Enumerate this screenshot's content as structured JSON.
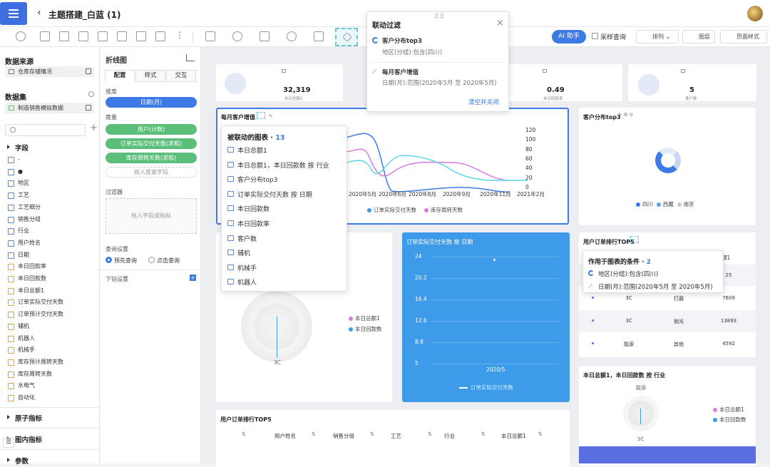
{
  "header": {
    "title": "主题搭建_白蓝 (1)"
  },
  "toolbar": {
    "ai_label": "AI 助手",
    "sample_label": "采样查询",
    "sort_label": "排列",
    "layer_label": "图层",
    "page_style_label": "页面样式"
  },
  "left": {
    "datasource_title": "数据来源",
    "datasource_item": "仓库存储情况",
    "dataset_title": "数据集",
    "dataset_item": "制造销售模拟数据",
    "fields_title": "字段",
    "fields": [
      "-",
      "●",
      "地区",
      "工艺",
      "工艺细分",
      "销售分组",
      "行业",
      "用户姓名",
      "日期",
      "本日回款率",
      "本日回款数",
      "本日总额1",
      "订单实际交付天数",
      "订单预计交付天数",
      "辅机",
      "机器人",
      "机械手",
      "库存预计周转天数",
      "库存周转天数",
      "水电气",
      "自动化"
    ],
    "cat_atomic": "原子指标",
    "cat_inmap": "图内指标",
    "cat_params": "参数"
  },
  "config": {
    "chart_type": "折线图",
    "tabs": [
      "配置",
      "样式",
      "交互"
    ],
    "dimension_label": "维度",
    "dimension_value": "日期(月)",
    "measure_label": "度量",
    "measures": [
      "用户(计数)",
      "订单实际交付天数(求和)",
      "库存周转天数(求和)"
    ],
    "measure_drop": "拖入度量字段",
    "filter_label": "过滤器",
    "filter_drop": "拖入字段或指标",
    "query_label": "查询设置",
    "query_opt1": "预先查询",
    "query_opt2": "点击查询",
    "drill_label": "下钻设置"
  },
  "kpis": [
    {
      "value": "32,319",
      "sub": "本日总额1"
    },
    {
      "value": "0.49",
      "sub": "本日回款率"
    },
    {
      "value": "5",
      "sub": "客户数"
    }
  ],
  "monthly_chart": {
    "title": "每月客户增值",
    "ticks_right": [
      "120",
      "100",
      "80",
      "60",
      "40",
      "20",
      "0"
    ],
    "x_ticks": [
      "2020年5月",
      "2020年6月",
      "2020年8月",
      "2020年9月",
      "2020年11月",
      "2021年2月"
    ],
    "legend": [
      "订单实际交付天数",
      "库存周转天数"
    ]
  },
  "pie_chart": {
    "title": "客户分布top3",
    "legend": [
      "四川",
      "西藏",
      "南京"
    ]
  },
  "blue_chart": {
    "title": "订单实际交付天数 按 日期",
    "yticks": [
      "24",
      "20.2",
      "16.4",
      "12.6",
      "8.8",
      "5"
    ],
    "xtick": "2020/5",
    "legend": "订单实际交付天数"
  },
  "radar_left": {
    "legend": [
      "本日总额1",
      "本日回款数"
    ],
    "label": "3C"
  },
  "rank_card": {
    "title": "用户订单排行TOP5",
    "header_partial": "额1",
    "rows": [
      {
        "c1": "",
        "c2": "",
        "c3": "25"
      },
      {
        "c1": "3C",
        "c2": "打磨",
        "c3": "7609"
      },
      {
        "c1": "3C",
        "c2": "抛光",
        "c3": "13893"
      },
      {
        "c1": "能源",
        "c2": "其他",
        "c3": "4592"
      }
    ]
  },
  "bottom_table": {
    "title": "用户订单排行TOP5",
    "headers": [
      "用户姓名",
      "销售分组",
      "工艺",
      "行业",
      "本日总额1"
    ]
  },
  "radar_right": {
    "title": "本日总额1，本日回款数 按 行业",
    "top_label": "能源",
    "bottom_label": "3C",
    "legend": [
      "本日总额1",
      "本日回款数"
    ]
  },
  "linked_popup": {
    "title": "被联动的图表",
    "count": "13",
    "items": [
      "本日总额1",
      "本日总额1，本日回款数 按 行业",
      "客户分布top3",
      "订单实际交付天数 按 日期",
      "本日回款数",
      "本日回款率",
      "客户数",
      "辅机",
      "机械手",
      "机器人"
    ]
  },
  "filter_popup": {
    "title": "联动过滤",
    "entry1_title": "客户分布top3",
    "entry1_cond": "地区(分组):包含(四川)",
    "entry2_title": "每月客户增值",
    "entry2_cond": "日期(月):范围(2020年5月 至 2020年5月)",
    "clear_label": "清空并关闭"
  },
  "conditions_popup": {
    "title": "作用于图表的条件",
    "count": "2",
    "items": [
      "地区(分组):包含(四川)",
      "日期(月):范围(2020年5月 至 2020年5月)"
    ]
  },
  "colors": {
    "accent": "#3d7ae6",
    "cyan": "#5ed6e6",
    "pink": "#d87be0",
    "blue_card": "#3d9be9"
  }
}
